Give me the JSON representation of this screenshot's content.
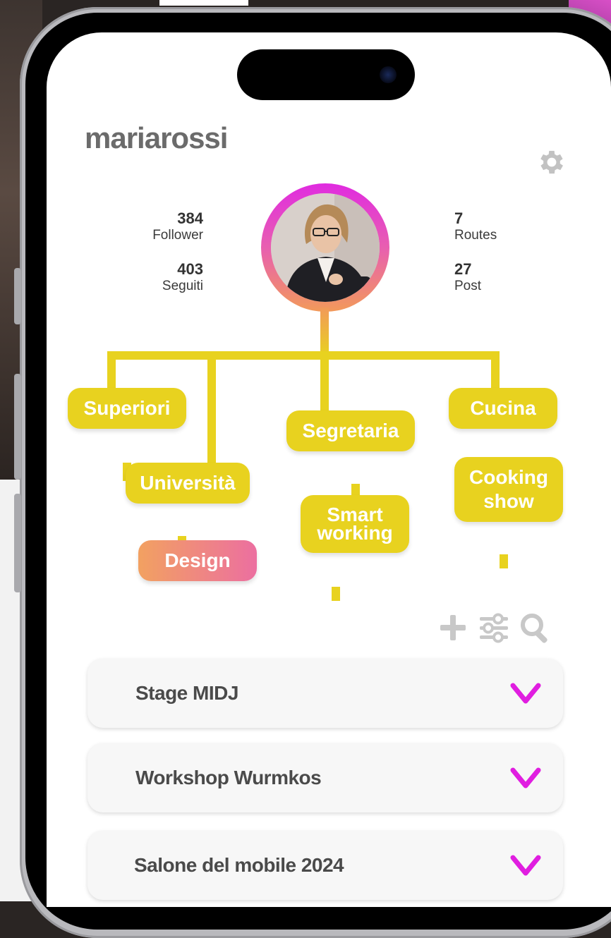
{
  "profile": {
    "username": "mariarossi",
    "stats": {
      "followers": {
        "value": "384",
        "label": "Follower"
      },
      "following": {
        "value": "403",
        "label": "Seguiti"
      },
      "routes": {
        "value": "7",
        "label": "Routes"
      },
      "posts": {
        "value": "27",
        "label": "Post"
      }
    }
  },
  "tree": {
    "superiori": "Superiori",
    "universita": "Università",
    "design": "Design",
    "segretaria": "Segretaria",
    "smart_working_1": "Smart",
    "smart_working_2": "working",
    "cucina": "Cucina",
    "cooking_show_1": "Cooking",
    "cooking_show_2": "show"
  },
  "routes_list": [
    {
      "title": "Stage MIDJ"
    },
    {
      "title": "Workshop Wurmkos"
    },
    {
      "title": "Salone del mobile 2024"
    }
  ],
  "colors": {
    "branch": "#e8d21f",
    "accent": "#e02be0",
    "design_gradient_start": "#f2a161",
    "design_gradient_end": "#ec6fa0"
  },
  "icons": [
    "settings-gear-icon",
    "add-plus-icon",
    "filter-sliders-icon",
    "search-icon",
    "chevron-down-icon"
  ]
}
